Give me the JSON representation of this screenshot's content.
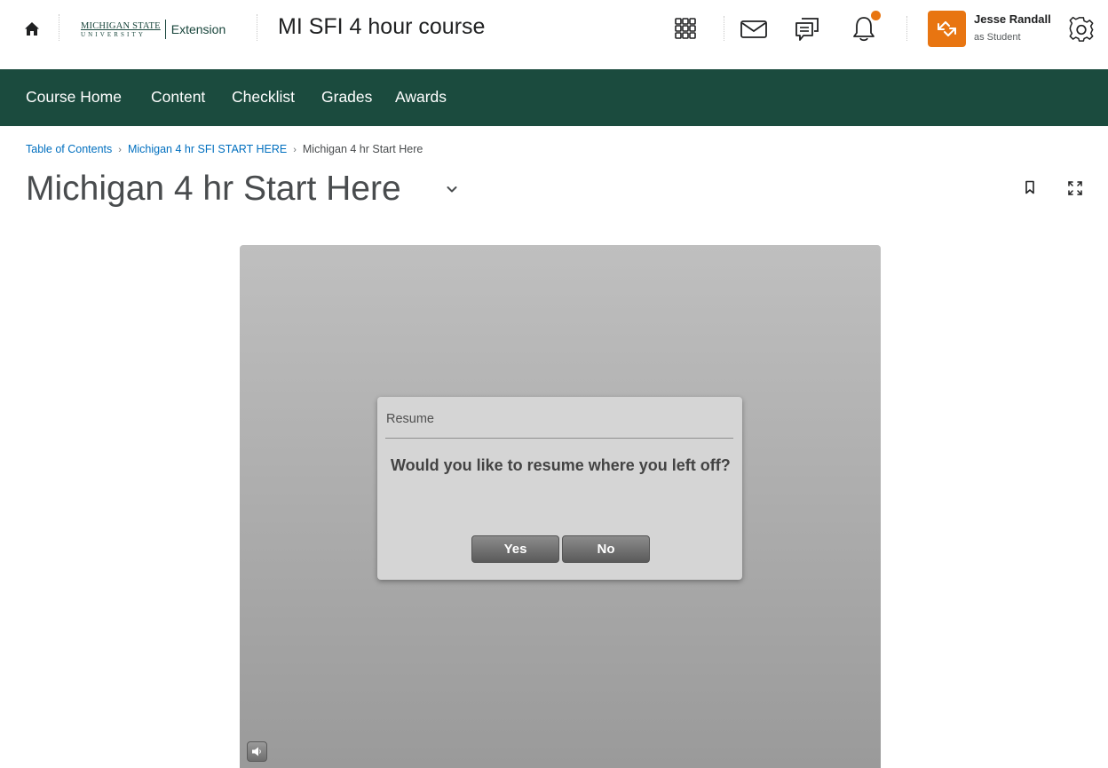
{
  "header": {
    "logo": {
      "line1": "MICHIGAN STATE",
      "line2": "UNIVERSITY",
      "extension": "Extension"
    },
    "course_title": "MI SFI 4 hour course",
    "user": {
      "name": "Jesse Randall",
      "role": "as Student"
    },
    "icons": [
      "home-icon",
      "apps-grid-icon",
      "mail-icon",
      "chat-icon",
      "bell-icon",
      "swap-icon",
      "gear-icon"
    ],
    "notification_color": "#e87511"
  },
  "nav": {
    "items": [
      {
        "label": "Course Home"
      },
      {
        "label": "Content"
      },
      {
        "label": "Checklist"
      },
      {
        "label": "Grades"
      },
      {
        "label": "Awards"
      }
    ],
    "background": "#1b4b3e"
  },
  "breadcrumb": {
    "items": [
      {
        "label": "Table of Contents"
      },
      {
        "label": "Michigan 4 hr SFI START HERE"
      }
    ],
    "current": "Michigan 4 hr Start Here"
  },
  "page": {
    "title": "Michigan 4 hr Start Here"
  },
  "dialog": {
    "title": "Resume",
    "message": "Would you like to resume where you left off?",
    "yes_label": "Yes",
    "no_label": "No"
  },
  "player": {
    "icons": [
      "volume-icon"
    ]
  }
}
